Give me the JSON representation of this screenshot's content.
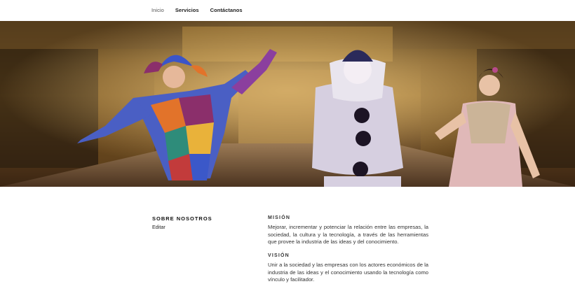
{
  "nav": {
    "items": [
      {
        "label": "Inicio",
        "current": true
      },
      {
        "label": "Servicios",
        "current": false
      },
      {
        "label": "Contáctanos",
        "current": false
      }
    ]
  },
  "hero": {
    "description_icon": "hero-banner-image",
    "colors": {
      "hall_gold": "#b9893f",
      "hall_dark": "#3a2a14",
      "floor": "#6a4a2c"
    }
  },
  "about": {
    "title": "SOBRE NOSOTROS",
    "edit_label": "Editar"
  },
  "mision": {
    "heading": "MISIÓN",
    "text": "Mejorar, incrementar y potenciar la relación entre las empresas, la sociedad, la cultura y la tecnología, a través de las herramientas que provee la industria de las ideas y del conocimiento."
  },
  "vision": {
    "heading": "VISIÓN",
    "text": "Unir a la sociedad y las empresas con los actores económicos de la industria de las ideas y el conocimiento usando la tecnología como vínculo y facilitador."
  }
}
